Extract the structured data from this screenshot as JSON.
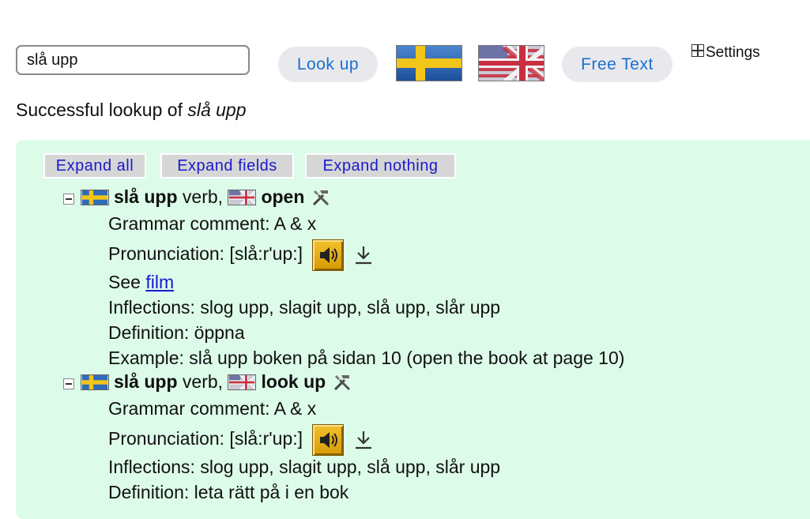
{
  "search": {
    "value": "slå upp",
    "lookup_label": "Look up",
    "free_text_label": "Free Text",
    "settings_label": "Settings"
  },
  "flags": {
    "swedish": "swedish-flag",
    "english": "uk-us-flag"
  },
  "status": {
    "prefix": "Successful lookup of ",
    "term": "slå upp"
  },
  "expand": {
    "all": "Expand all",
    "fields": "Expand fields",
    "nothing": "Expand nothing"
  },
  "entries": [
    {
      "word": "slå upp",
      "pos": " verb, ",
      "translation": "open",
      "grammar": "Grammar comment: A & x",
      "pronunciation": "Pronunciation: [slå:r'up:]",
      "see_prefix": "See ",
      "see_link": "film",
      "inflections": "Inflections: slog upp, slagit upp, slå upp, slår upp",
      "definition": "Definition: öppna",
      "example": "Example: slå upp boken på sidan 10 (open the book at page 10)"
    },
    {
      "word": "slå upp",
      "pos": " verb, ",
      "translation": "look up",
      "grammar": "Grammar comment: A & x",
      "pronunciation": "Pronunciation: [slå:r'up:]",
      "inflections": "Inflections: slog upp, slagit upp, slå upp, slår upp",
      "definition": "Definition: leta rätt på i en bok"
    }
  ],
  "colors": {
    "panel": "#ddfbe9",
    "link": "#1a1acc",
    "pill_text": "#1a6fd1"
  }
}
